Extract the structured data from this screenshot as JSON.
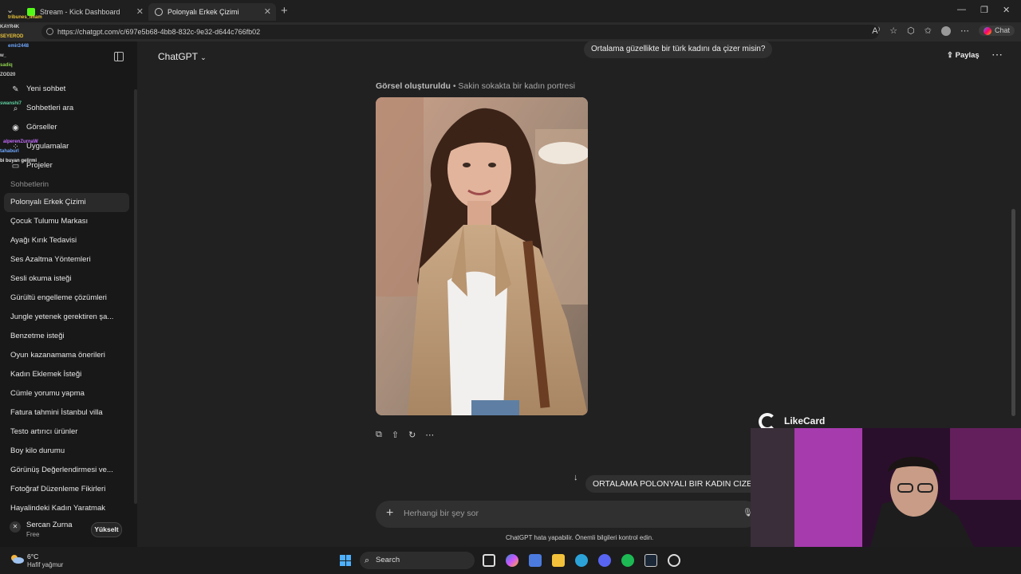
{
  "browser": {
    "tabs": [
      {
        "title": "Stream - Kick Dashboard",
        "active": false
      },
      {
        "title": "Polonyalı Erkek Çizimi",
        "active": true
      }
    ],
    "url": "https://chatgpt.com/c/697e5b68-4bb8-832c-9e32-d644c766fb02",
    "chat_button": "Chat"
  },
  "sidebar": {
    "menu": [
      {
        "label": "Yeni sohbet",
        "icon": "edit-icon"
      },
      {
        "label": "Sohbetleri ara",
        "icon": "search-icon"
      },
      {
        "label": "Görseller",
        "icon": "image-icon"
      },
      {
        "label": "Uygulamalar",
        "icon": "apps-icon"
      },
      {
        "label": "Projeler",
        "icon": "folder-icon"
      }
    ],
    "section_title": "Sohbetlerin",
    "chats": [
      "Polonyalı Erkek Çizimi",
      "Çocuk Tulumu Markası",
      "Ayağı Kırık Tedavisi",
      "Ses Azaltma Yöntemleri",
      "Sesli okuma isteği",
      "Gürültü engelleme çözümleri",
      "Jungle yetenek gerektiren şa...",
      "Benzetme isteği",
      "Oyun kazanamama önerileri",
      "Kadın Eklemek İsteği",
      "Cümle yorumu yapma",
      "Fatura tahmini İstanbul villa",
      "Testo artırıcı ürünler",
      "Boy kilo durumu",
      "Görünüş Değerlendirmesi ve...",
      "Fotoğraf Düzenleme Fikirleri",
      "Hayalindeki Kadın Yaratmak"
    ],
    "user": {
      "name": "Sercan Zurna",
      "plan": "Free",
      "upgrade_label": "Yükselt"
    }
  },
  "stream_chat_overlay": [
    {
      "user": "tribunes_Imam",
      "color": "#e8c33a"
    },
    {
      "user": "KAYR4K",
      "color": "#cfcfcf"
    },
    {
      "user": "SEYEROD",
      "color": "#e8c33a"
    },
    {
      "user": "emir2448",
      "color": "#6fa8ff"
    },
    {
      "user": "w_",
      "color": "#cfcfcf"
    },
    {
      "user": "sadiq",
      "color": "#8fd14f"
    },
    {
      "user": "ZOD20",
      "color": "#cfcfcf"
    },
    {
      "user": "swanshi7",
      "color": "#5fd1a0"
    },
    {
      "user": "alperenZurnaW",
      "color": "#c46bff"
    },
    {
      "user": "tahaburl",
      "color": "#6fa8ff"
    },
    {
      "user": "bi buyan gelirmi",
      "color": "#e6e6e6"
    }
  ],
  "main": {
    "header_title": "ChatGPT",
    "share_label": "Paylaş",
    "user_message_1": "Ortalama güzellikte bir türk kadını da çizer misin?",
    "image_caption_bold": "Görsel oluşturuldu",
    "image_caption_rest": " • Sakin sokakta bir kadın portresi",
    "user_message_2": "ORTALAMA POLONYALI BIR KADIN CIZER M",
    "composer_placeholder": "Herhangi bir şey sor",
    "disclaimer": "ChatGPT hata yapabilir. Önemli bilgileri kontrol edin."
  },
  "overlay": {
    "brand": "LikeCard"
  },
  "taskbar": {
    "temperature": "6°C",
    "weather": "Hafif yağmur",
    "search_label": "Search"
  },
  "colors": {
    "background": "#212121",
    "sidebar": "#181818",
    "bubble": "#303030",
    "accent": "#4fb0ff"
  }
}
